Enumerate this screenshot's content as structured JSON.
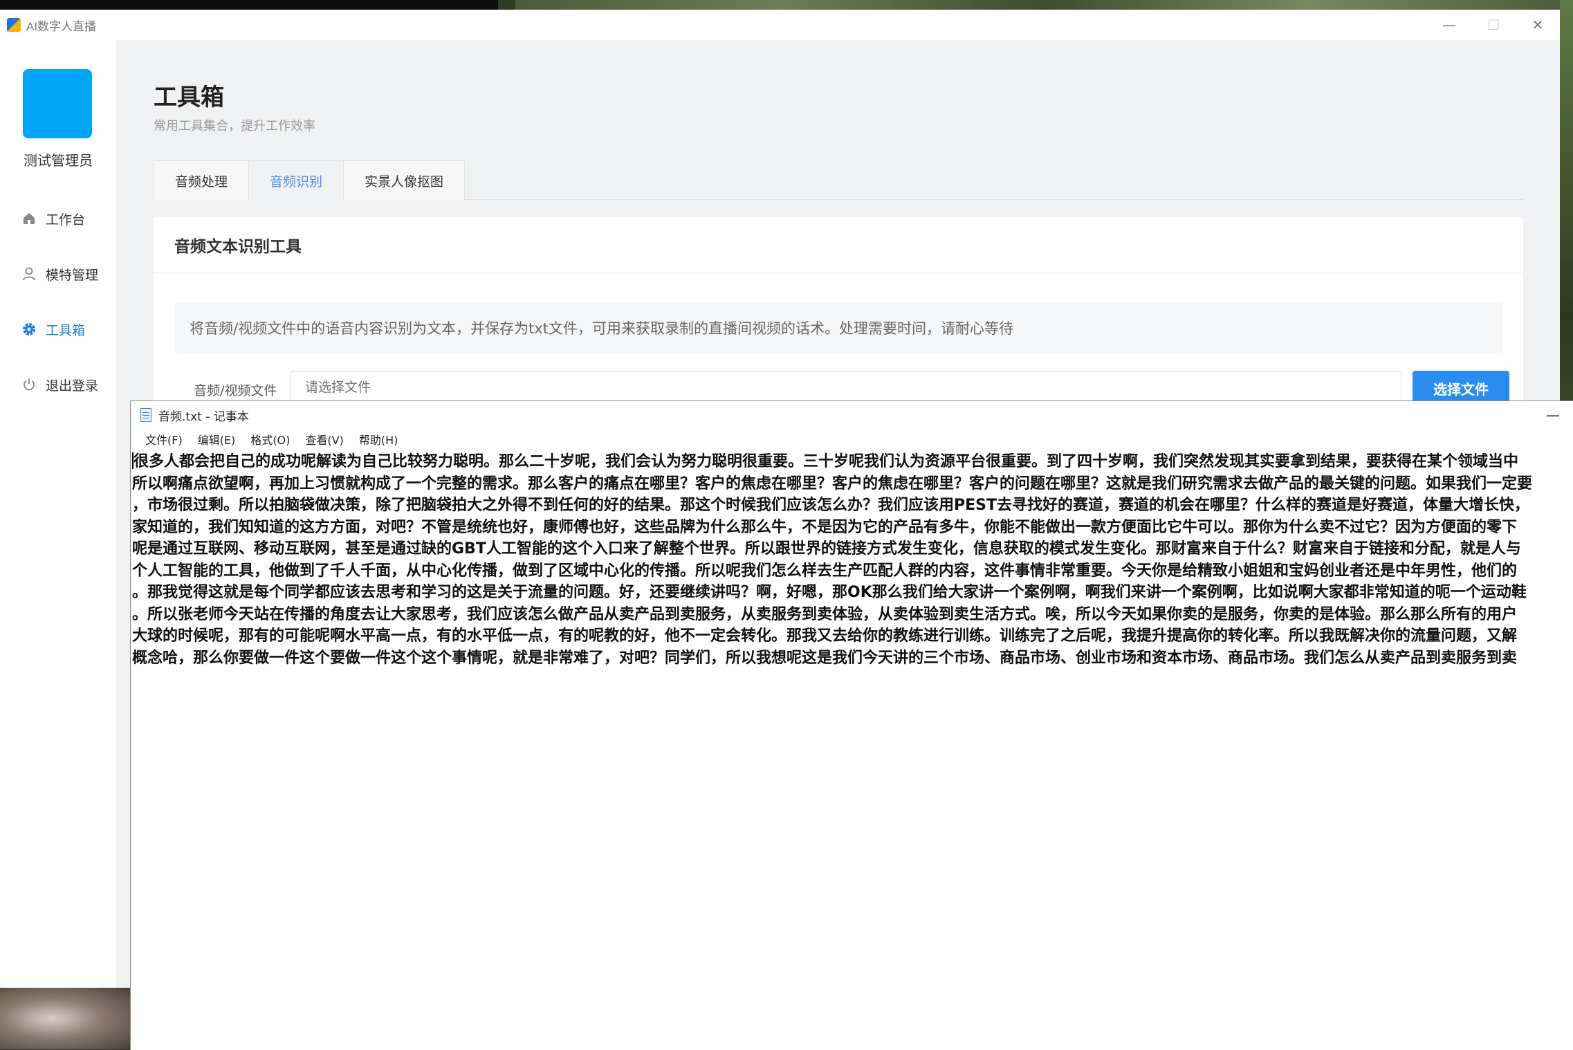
{
  "app": {
    "title": "AI数字人直播",
    "controls": {
      "minimize": "—",
      "maximize": "☐",
      "close": "✕"
    }
  },
  "sidebar": {
    "username": "测试管理员",
    "items": [
      {
        "label": "工作台",
        "icon": "home-icon"
      },
      {
        "label": "模特管理",
        "icon": "user-icon"
      },
      {
        "label": "工具箱",
        "icon": "gear-icon",
        "active": true
      },
      {
        "label": "退出登录",
        "icon": "power-icon"
      }
    ]
  },
  "page": {
    "title": "工具箱",
    "subtitle": "常用工具集合，提升工作效率",
    "tabs": [
      {
        "label": "音频处理"
      },
      {
        "label": "音频识别",
        "active": true
      },
      {
        "label": "实景人像抠图"
      }
    ]
  },
  "card": {
    "title": "音频文本识别工具",
    "info": "将音频/视频文件中的语音内容识别为文本，并保存为txt文件，可用来获取录制的直播间视频的话术。处理需要时间，请耐心等待",
    "file_label": "音频/视频文件",
    "file_placeholder": "请选择文件",
    "file_button": "选择文件"
  },
  "notepad": {
    "title": "音频.txt - 记事本",
    "minimize": "—",
    "menu": [
      "文件(F)",
      "编辑(E)",
      "格式(O)",
      "查看(V)",
      "帮助(H)"
    ],
    "lines": [
      "很多人都会把自己的成功呢解读为自己比较努力聪明。那么二十岁呢，我们会认为努力聪明很重要。三十岁呢我们认为资源平台很重要。到了四十岁啊，我们突然发现其实要拿到结果，要获得在某个领域当中",
      "所以啊痛点欲望啊，再加上习惯就构成了一个完整的需求。那么客户的痛点在哪里？客户的焦虑在哪里？客户的焦虑在哪里？客户的问题在哪里？这就是我们研究需求去做产品的最关键的问题。如果我们一定要",
      "，市场很过剩。所以拍脑袋做决策，除了把脑袋拍大之外得不到任何的好的结果。那这个时候我们应该怎么办？我们应该用PEST去寻找好的赛道，赛道的机会在哪里？什么样的赛道是好赛道，体量大增长快，",
      "家知道的，我们知知道的这方方面，对吧？不管是统统也好，康师傅也好，这些品牌为什么那么牛，不是因为它的产品有多牛，你能不能做出一款方便面比它牛可以。那你为什么卖不过它？因为方便面的零下",
      "呢是通过互联网、移动互联网，甚至是通过缺的GBT人工智能的这个入口来了解整个世界。所以跟世界的链接方式发生变化，信息获取的模式发生变化。那财富来自于什么？财富来自于链接和分配，就是人与",
      "个人工智能的工具，他做到了千人千面，从中心化传播，做到了区域中心化的传播。所以呢我们怎么样去生产匹配人群的内容，这件事情非常重要。今天你是给精致小姐姐和宝妈创业者还是中年男性，他们的",
      "。那我觉得这就是每个同学都应该去思考和学习的这是关于流量的问题。好，还要继续讲吗？啊，好嗯，那OK那么我们给大家讲一个案例啊，啊我们来讲一个案例啊，比如说啊大家都非常知道的呃一个运动鞋",
      "。所以张老师今天站在传播的角度去让大家思考，我们应该怎么做产品从卖产品到卖服务，从卖服务到卖体验，从卖体验到卖生活方式。唉，所以今天如果你卖的是服务，你卖的是体验。那么那么所有的用户",
      "大球的时候呢，那有的可能呢啊水平高一点，有的水平低一点，有的呢教的好，他不一定会转化。那我又去给你的教练进行训练。训练完了之后呢，我提升提高你的转化率。所以我既解决你的流量问题，又解",
      "概念哈，那么你要做一件这个要做一件这个这个事情呢，就是非常难了，对吧？同学们，所以我想呢这是我们今天讲的三个市场、商品市场、创业市场和资本市场、商品市场。我们怎么从卖产品到卖服务到卖"
    ]
  }
}
